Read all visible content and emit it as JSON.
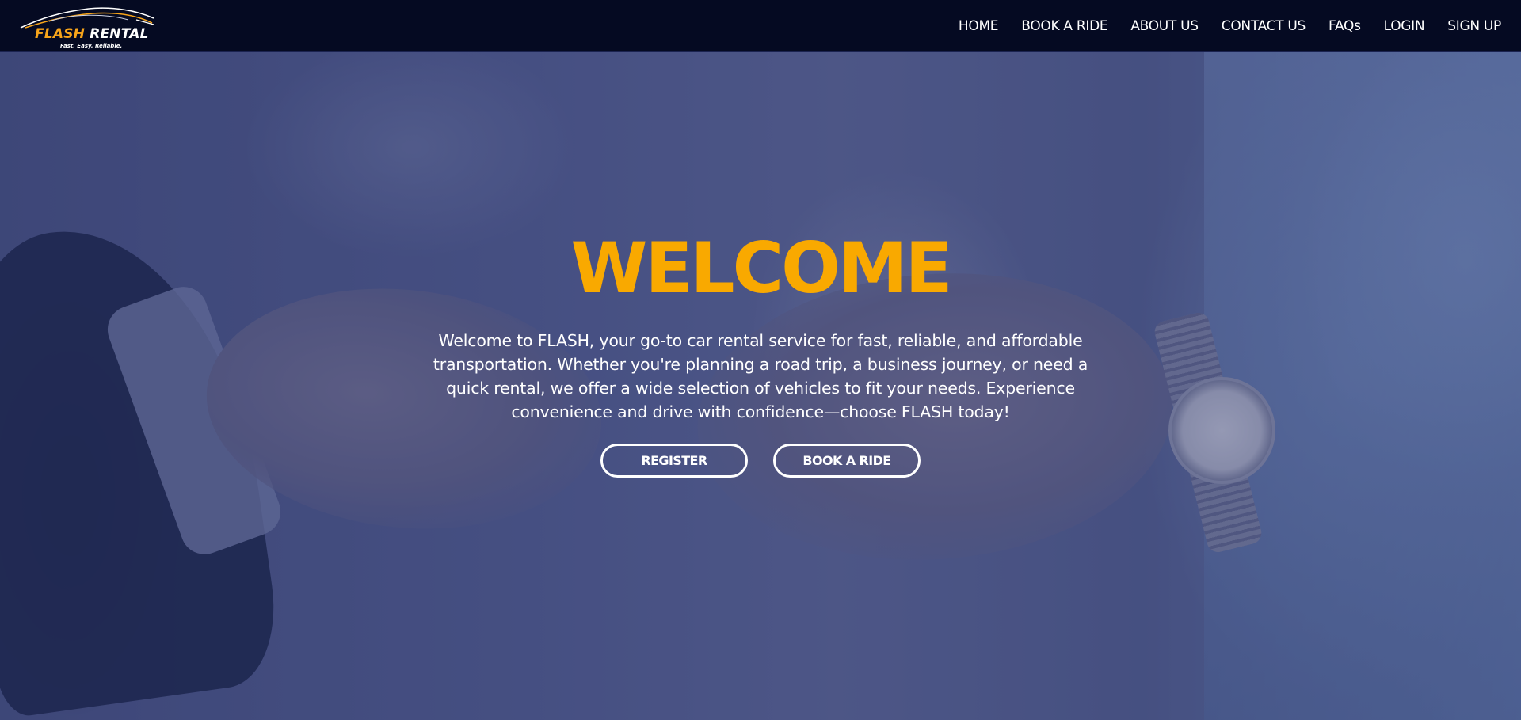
{
  "brand": {
    "name_part1": "FLASH ",
    "name_part2": "RENTAL",
    "tagline": "Fast. Easy. Reliable.",
    "accent_color": "#f7a41a"
  },
  "nav": {
    "items": [
      {
        "label": "HOME"
      },
      {
        "label": "BOOK A RIDE"
      },
      {
        "label": "ABOUT US"
      },
      {
        "label": "CONTACT US"
      },
      {
        "label": "FAQs"
      },
      {
        "label": "LOGIN"
      },
      {
        "label": "SIGN UP"
      }
    ]
  },
  "hero": {
    "title": "WELCOME",
    "title_color": "#f9a900",
    "description": "Welcome to FLASH, your go-to car rental service for fast, reliable, and affordable transportation. Whether you're planning a road trip, a business journey, or need a quick rental, we offer a wide selection of vehicles to fit your needs. Experience convenience and drive with confidence—choose FLASH today!",
    "buttons": {
      "register_label": "REGISTER",
      "book_label": "BOOK A RIDE"
    }
  }
}
